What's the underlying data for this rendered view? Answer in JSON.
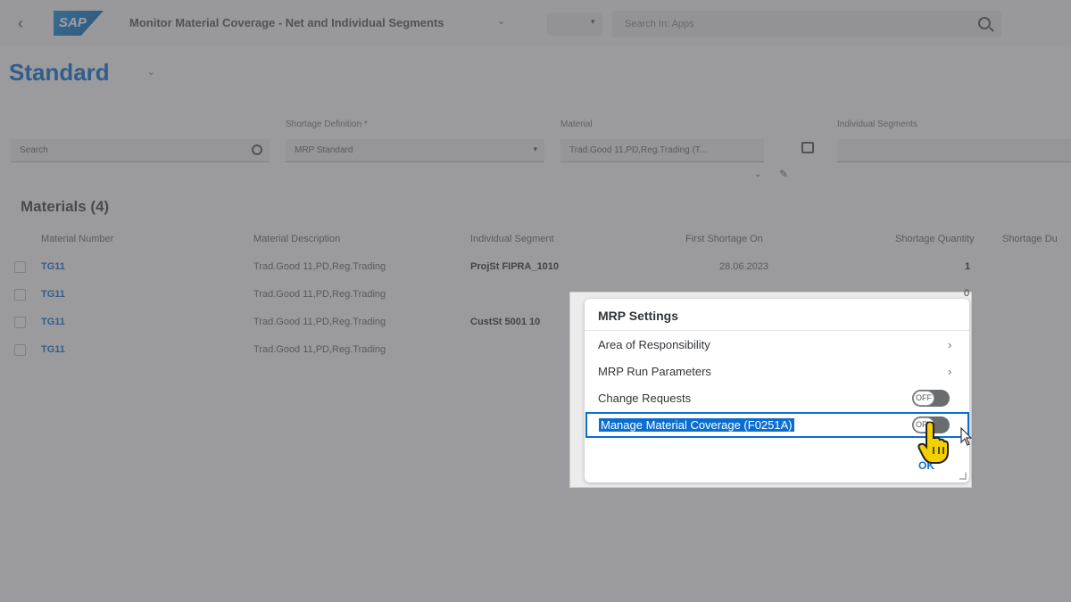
{
  "shell": {
    "logo_text": "SAP",
    "app_title": "Monitor Material Coverage - Net and Individual Segments",
    "search_placeholder": "Search In: Apps"
  },
  "page": {
    "variant": "Standard",
    "filters": {
      "search_placeholder": "Search",
      "shortage_label": "Shortage Definition *",
      "shortage_value": "MRP Standard",
      "material_label": "Material",
      "material_value": "Trad.Good 11,PD,Reg.Trading (T...",
      "segment_label": "Individual Segments"
    },
    "table": {
      "title": "Materials (4)",
      "columns": [
        "Material Number",
        "Material Description",
        "Individual Segment",
        "First Shortage On",
        "Shortage Quantity",
        "Shortage Du"
      ],
      "rows": [
        {
          "number": "TG11",
          "description": "Trad.Good 11,PD,Reg.Trading",
          "segment": "ProjSt FIPRA_1010",
          "shortage_on": "28.06.2023",
          "quantity": "1"
        },
        {
          "number": "TG11",
          "description": "Trad.Good 11,PD,Reg.Trading",
          "segment": "",
          "shortage_on": "",
          "quantity": ""
        },
        {
          "number": "TG11",
          "description": "Trad.Good 11,PD,Reg.Trading",
          "segment": "CustSt 5001 10",
          "shortage_on": "",
          "quantity": ""
        },
        {
          "number": "TG11",
          "description": "Trad.Good 11,PD,Reg.Trading",
          "segment": "",
          "shortage_on": "",
          "quantity": ""
        }
      ],
      "stray_value": "0"
    }
  },
  "dialog": {
    "title": "MRP Settings",
    "items": [
      {
        "label": "Area of Responsibility",
        "kind": "nav"
      },
      {
        "label": "MRP Run Parameters",
        "kind": "nav"
      },
      {
        "label": "Change Requests",
        "kind": "toggle",
        "state": "OFF"
      },
      {
        "label": "Manage Material Coverage (F0251A)",
        "kind": "toggle",
        "state": "OFF",
        "selected": true
      }
    ],
    "ok_label": "OK"
  },
  "colors": {
    "accent": "#0a6ed1",
    "toggle_off": "#6a6d70",
    "cursor_hand": "#f5d000"
  }
}
